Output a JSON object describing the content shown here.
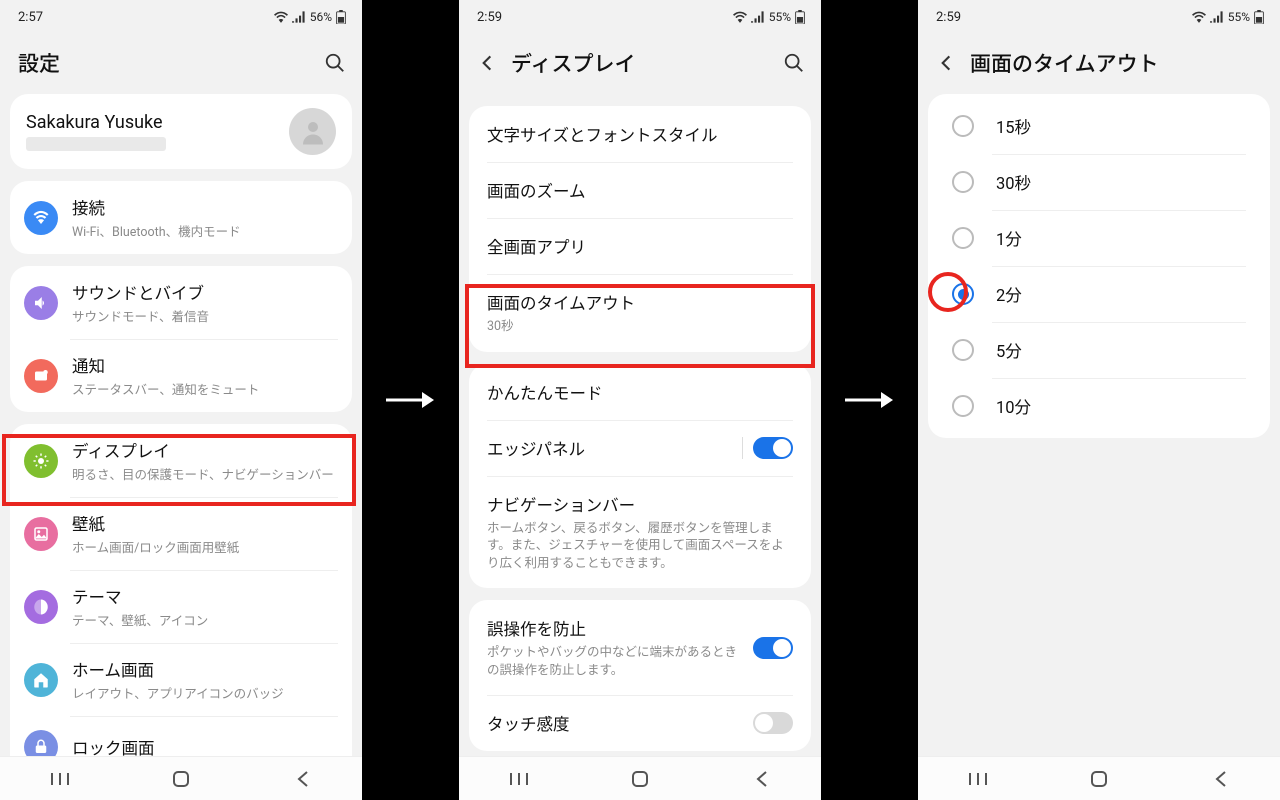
{
  "phone1": {
    "time": "2:57",
    "battery": "56%",
    "title": "設定",
    "profile_name": "Sakakura Yusuke",
    "items": [
      {
        "label": "接続",
        "sub": "Wi-Fi、Bluetooth、機内モード"
      },
      {
        "label": "サウンドとバイブ",
        "sub": "サウンドモード、着信音"
      },
      {
        "label": "通知",
        "sub": "ステータスバー、通知をミュート"
      },
      {
        "label": "ディスプレイ",
        "sub": "明るさ、目の保護モード、ナビゲーションバー"
      },
      {
        "label": "壁紙",
        "sub": "ホーム画面/ロック画面用壁紙"
      },
      {
        "label": "テーマ",
        "sub": "テーマ、壁紙、アイコン"
      },
      {
        "label": "ホーム画面",
        "sub": "レイアウト、アプリアイコンのバッジ"
      },
      {
        "label": "ロック画面",
        "sub": ""
      }
    ]
  },
  "phone2": {
    "time": "2:59",
    "battery": "55%",
    "title": "ディスプレイ",
    "g1": [
      {
        "label": "文字サイズとフォントスタイル"
      },
      {
        "label": "画面のズーム"
      },
      {
        "label": "全画面アプリ"
      },
      {
        "label": "画面のタイムアウト",
        "sub": "30秒",
        "sub_blue": true
      }
    ],
    "g2": [
      {
        "label": "かんたんモード"
      },
      {
        "label": "エッジパネル",
        "toggle": true,
        "on": true,
        "divider": true
      },
      {
        "label": "ナビゲーションバー",
        "sub": "ホームボタン、戻るボタン、履歴ボタンを管理します。また、ジェスチャーを使用して画面スペースをより広く利用することもできます。"
      }
    ],
    "g3": [
      {
        "label": "誤操作を防止",
        "sub": "ポケットやバッグの中などに端末があるときの誤操作を防止します。",
        "toggle": true,
        "on": true
      },
      {
        "label": "タッチ感度",
        "toggle": true,
        "on": false
      }
    ]
  },
  "phone3": {
    "time": "2:59",
    "battery": "55%",
    "title": "画面のタイムアウト",
    "options": [
      "15秒",
      "30秒",
      "1分",
      "2分",
      "5分",
      "10分"
    ],
    "selected_index": 3
  }
}
